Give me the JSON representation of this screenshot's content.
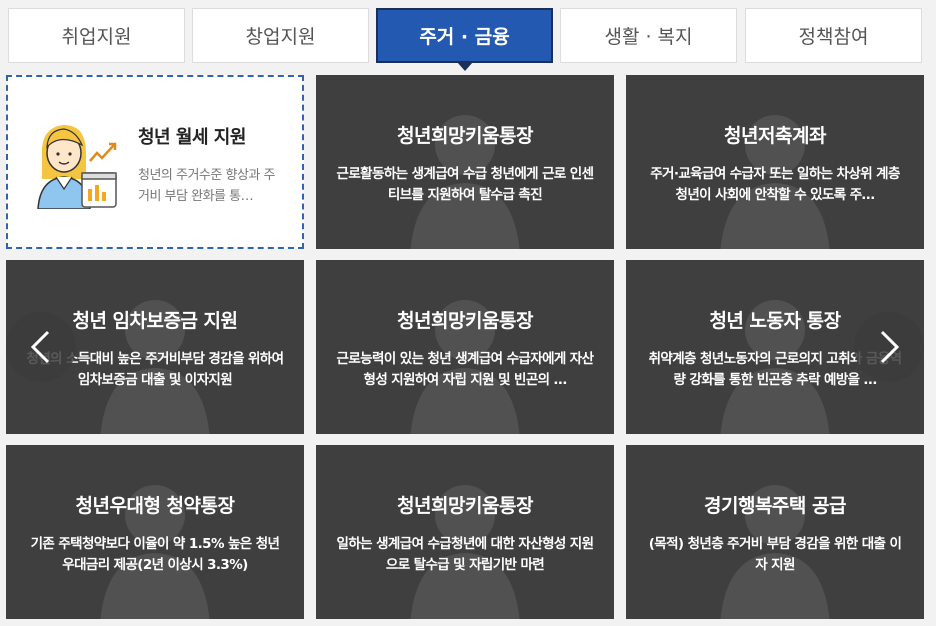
{
  "tabs": [
    {
      "label": "취업지원"
    },
    {
      "label": "창업지원"
    },
    {
      "label": "주거 · 금융"
    },
    {
      "label": "생활 · 복지"
    },
    {
      "label": "정책참여"
    }
  ],
  "active_tab": 2,
  "featured_card": {
    "title": "청년 월세 지원",
    "desc": "청년의 주거수준 향상과 주거비 부담 완화를 통…"
  },
  "cards": [
    {
      "title": "청년희망키움통장",
      "desc": "근로활동하는 생계급여 수급 청년에게 근로 인센티브를 지원하여 탈수급 촉진"
    },
    {
      "title": "청년저축계좌",
      "desc": "주거·교육급여 수급자 또는 일하는 차상위 계층 청년이 사회에 안착할 수 있도록 주…"
    },
    {
      "title": "청년 임차보증금 지원",
      "desc": "청년의 소득대비 높은 주거비부담 경감을 위하여 임차보증금 대출 및 이자지원"
    },
    {
      "title": "청년희망키움통장",
      "desc": "근로능력이 있는 청년 생계급여 수급자에게 자산형성 지원하여 자립 지원 및 빈곤의 …"
    },
    {
      "title": "청년 노동자 통장",
      "desc": "취약계층 청년노동자의 근로의지 고취와 금융역량 강화를 통한 빈곤층 추락 예방을 …"
    },
    {
      "title": "청년우대형 청약통장",
      "desc": "기존 주택청약보다 이율이 약 1.5% 높은 청년우대금리 제공(2년 이상시 3.3%)"
    },
    {
      "title": "청년희망키움통장",
      "desc": "일하는 생계급여 수급청년에 대한 자산형성 지원으로 탈수급 및 자립기반 마련"
    },
    {
      "title": "경기행복주택 공급",
      "desc": "(목적) 청년층 주거비 부담 경감을 위한 대출 이자 지원"
    }
  ],
  "icons": {
    "prev": "chevron-left-icon",
    "next": "chevron-right-icon"
  },
  "colors": {
    "active_tab": "#2359b1",
    "card_bg": "#3f3f3f",
    "featured_border": "#2f63b6"
  }
}
